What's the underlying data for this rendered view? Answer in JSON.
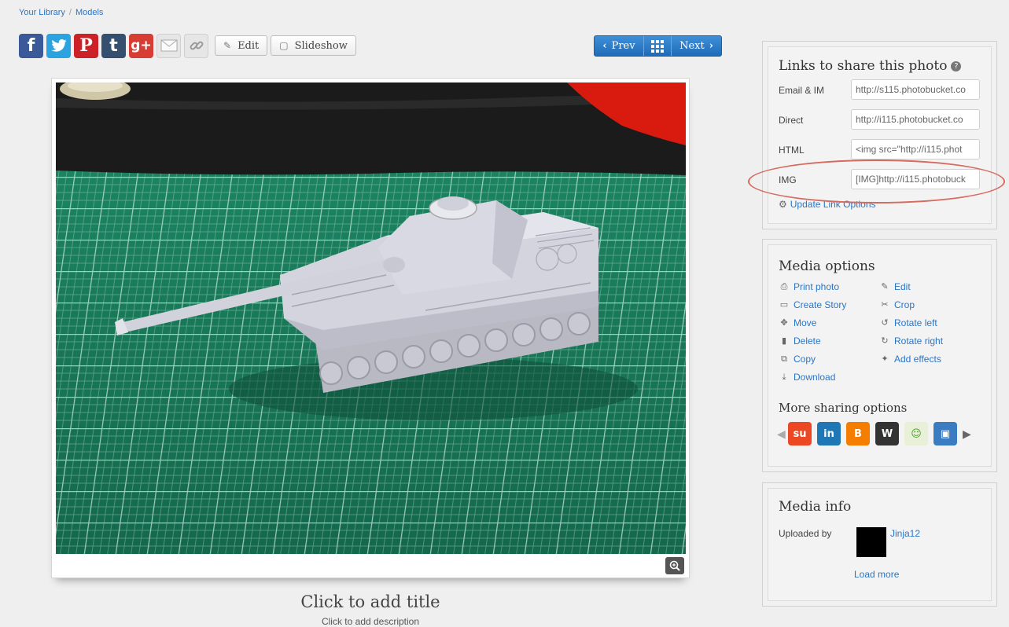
{
  "breadcrumb": {
    "items": [
      "Your Library",
      "Models"
    ],
    "separator": "/"
  },
  "toolbar": {
    "social": [
      {
        "name": "facebook",
        "glyph": "f"
      },
      {
        "name": "twitter",
        "glyph": "t"
      },
      {
        "name": "pinterest",
        "glyph": "P"
      },
      {
        "name": "tumblr",
        "glyph": "t"
      },
      {
        "name": "google-plus",
        "glyph": "g+"
      },
      {
        "name": "email",
        "glyph": ""
      },
      {
        "name": "link",
        "glyph": ""
      }
    ],
    "edit_label": "Edit",
    "slideshow_label": "Slideshow"
  },
  "pager": {
    "prev_label": "Prev",
    "next_label": "Next"
  },
  "photo": {
    "title_placeholder": "Click to add title",
    "description_placeholder": "Click to add description"
  },
  "links_panel": {
    "title": "Links to share this photo",
    "help_glyph": "?",
    "rows": [
      {
        "label": "Email & IM",
        "value": "http://s115.photobucket.co"
      },
      {
        "label": "Direct",
        "value": "http://i115.photobucket.co"
      },
      {
        "label": "HTML",
        "value": "<img src=\"http://i115.phot"
      },
      {
        "label": "IMG",
        "value": "[IMG]http://i115.photobuck"
      }
    ],
    "update_label": "Update Link Options"
  },
  "media_options": {
    "title": "Media options",
    "left": [
      {
        "label": "Print photo",
        "icon": "print-icon"
      },
      {
        "label": "Create Story",
        "icon": "story-icon"
      },
      {
        "label": "Move",
        "icon": "move-icon"
      },
      {
        "label": "Delete",
        "icon": "trash-icon"
      },
      {
        "label": "Copy",
        "icon": "copy-icon"
      },
      {
        "label": "Download",
        "icon": "download-icon"
      }
    ],
    "right": [
      {
        "label": "Edit",
        "icon": "edit-icon"
      },
      {
        "label": "Crop",
        "icon": "crop-icon"
      },
      {
        "label": "Rotate left",
        "icon": "rotate-left-icon"
      },
      {
        "label": "Rotate right",
        "icon": "rotate-right-icon"
      },
      {
        "label": "Add effects",
        "icon": "effects-icon"
      }
    ],
    "more_sharing_title": "More sharing options",
    "share_icons": [
      "stumbleupon-icon",
      "linkedin-icon",
      "blogger-icon",
      "wordpress-icon",
      "messenger-icon",
      "myspace-icon"
    ]
  },
  "media_info": {
    "title": "Media info",
    "uploaded_by_label": "Uploaded by",
    "uploader": "Jinja12",
    "load_more": "Load more"
  },
  "colors": {
    "link": "#2a76c6",
    "pager": "#1f6bb8",
    "annotation": "#d66a5e"
  }
}
